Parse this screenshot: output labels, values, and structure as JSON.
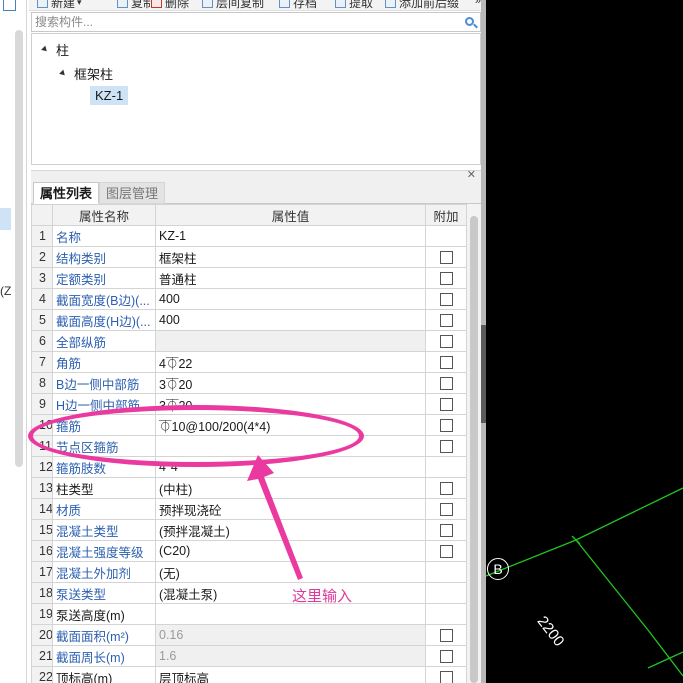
{
  "left_strip": {
    "partial_text": "(Z"
  },
  "toolbar": {
    "items": [
      {
        "label": "新建",
        "icon": "new-icon"
      },
      {
        "label": "复制",
        "icon": "copy-icon"
      },
      {
        "label": "删除",
        "icon": "delete-icon"
      },
      {
        "label": "层间复制",
        "icon": "floor-copy-icon"
      },
      {
        "label": "存档",
        "icon": "archive-icon"
      },
      {
        "label": "提取",
        "icon": "extract-icon"
      },
      {
        "label": "添加前后缀",
        "icon": "prefix-suffix-icon"
      }
    ],
    "more": "»"
  },
  "search": {
    "placeholder": "搜索构件..."
  },
  "tree": {
    "root": "柱",
    "child": "框架柱",
    "leaf": "KZ-1"
  },
  "tabs": [
    "属性列表",
    "图层管理"
  ],
  "table": {
    "headers": [
      "",
      "属性名称",
      "属性值",
      "附加"
    ],
    "rows": [
      {
        "num": "1",
        "name": "名称",
        "value": "KZ-1",
        "checkbox": false,
        "name_black": false,
        "value_style": ""
      },
      {
        "num": "2",
        "name": "结构类别",
        "value": "框架柱",
        "checkbox": true,
        "name_black": false,
        "value_style": ""
      },
      {
        "num": "3",
        "name": "定额类别",
        "value": "普通柱",
        "checkbox": true,
        "name_black": false,
        "value_style": ""
      },
      {
        "num": "4",
        "name": "截面宽度(B边)(...",
        "value": "400",
        "checkbox": true,
        "name_black": false,
        "value_style": ""
      },
      {
        "num": "5",
        "name": "截面高度(H边)(...",
        "value": "400",
        "checkbox": true,
        "name_black": false,
        "value_style": ""
      },
      {
        "num": "6",
        "name": "全部纵筋",
        "value": "",
        "checkbox": true,
        "name_black": false,
        "value_style": "shade"
      },
      {
        "num": "7",
        "name": "角筋",
        "value": "4⏁22",
        "checkbox": true,
        "name_black": false,
        "value_style": ""
      },
      {
        "num": "8",
        "name": "B边一侧中部筋",
        "value": "3⏁20",
        "checkbox": true,
        "name_black": false,
        "value_style": ""
      },
      {
        "num": "9",
        "name": "H边一侧中部筋",
        "value": "3⏁20",
        "checkbox": true,
        "name_black": false,
        "value_style": ""
      },
      {
        "num": "10",
        "name": "箍筋",
        "value": "⏁10@100/200(4*4)",
        "checkbox": true,
        "name_black": false,
        "value_style": ""
      },
      {
        "num": "11",
        "name": "节点区箍筋",
        "value": "",
        "checkbox": true,
        "name_black": false,
        "value_style": ""
      },
      {
        "num": "12",
        "name": "箍筋肢数",
        "value": "4*4",
        "checkbox": false,
        "name_black": false,
        "value_style": ""
      },
      {
        "num": "13",
        "name": "柱类型",
        "value": "(中柱)",
        "checkbox": true,
        "name_black": true,
        "value_style": ""
      },
      {
        "num": "14",
        "name": "材质",
        "value": "预拌现浇砼",
        "checkbox": true,
        "name_black": false,
        "value_style": ""
      },
      {
        "num": "15",
        "name": "混凝土类型",
        "value": "(预拌混凝土)",
        "checkbox": true,
        "name_black": false,
        "value_style": ""
      },
      {
        "num": "16",
        "name": "混凝土强度等级",
        "value": "(C20)",
        "checkbox": true,
        "name_black": false,
        "value_style": ""
      },
      {
        "num": "17",
        "name": "混凝土外加剂",
        "value": "(无)",
        "checkbox": false,
        "name_black": false,
        "value_style": ""
      },
      {
        "num": "18",
        "name": "泵送类型",
        "value": "(混凝土泵)",
        "checkbox": false,
        "name_black": false,
        "value_style": ""
      },
      {
        "num": "19",
        "name": "泵送高度(m)",
        "value": "",
        "checkbox": false,
        "name_black": true,
        "value_style": ""
      },
      {
        "num": "20",
        "name": "截面面积(m²)",
        "value": "0.16",
        "checkbox": true,
        "name_black": false,
        "value_style": "gray"
      },
      {
        "num": "21",
        "name": "截面周长(m)",
        "value": "1.6",
        "checkbox": true,
        "name_black": false,
        "value_style": "gray"
      },
      {
        "num": "22",
        "name": "顶标高(m)",
        "value": "层顶标高",
        "checkbox": true,
        "name_black": true,
        "value_style": ""
      }
    ]
  },
  "annotation": {
    "text": "这里输入"
  },
  "cad": {
    "axis_label": "B",
    "dimension": "2200"
  },
  "colors": {
    "accent": "#2b5fb0",
    "annotation": "#ea3aa0",
    "cad_line": "#22c322"
  }
}
